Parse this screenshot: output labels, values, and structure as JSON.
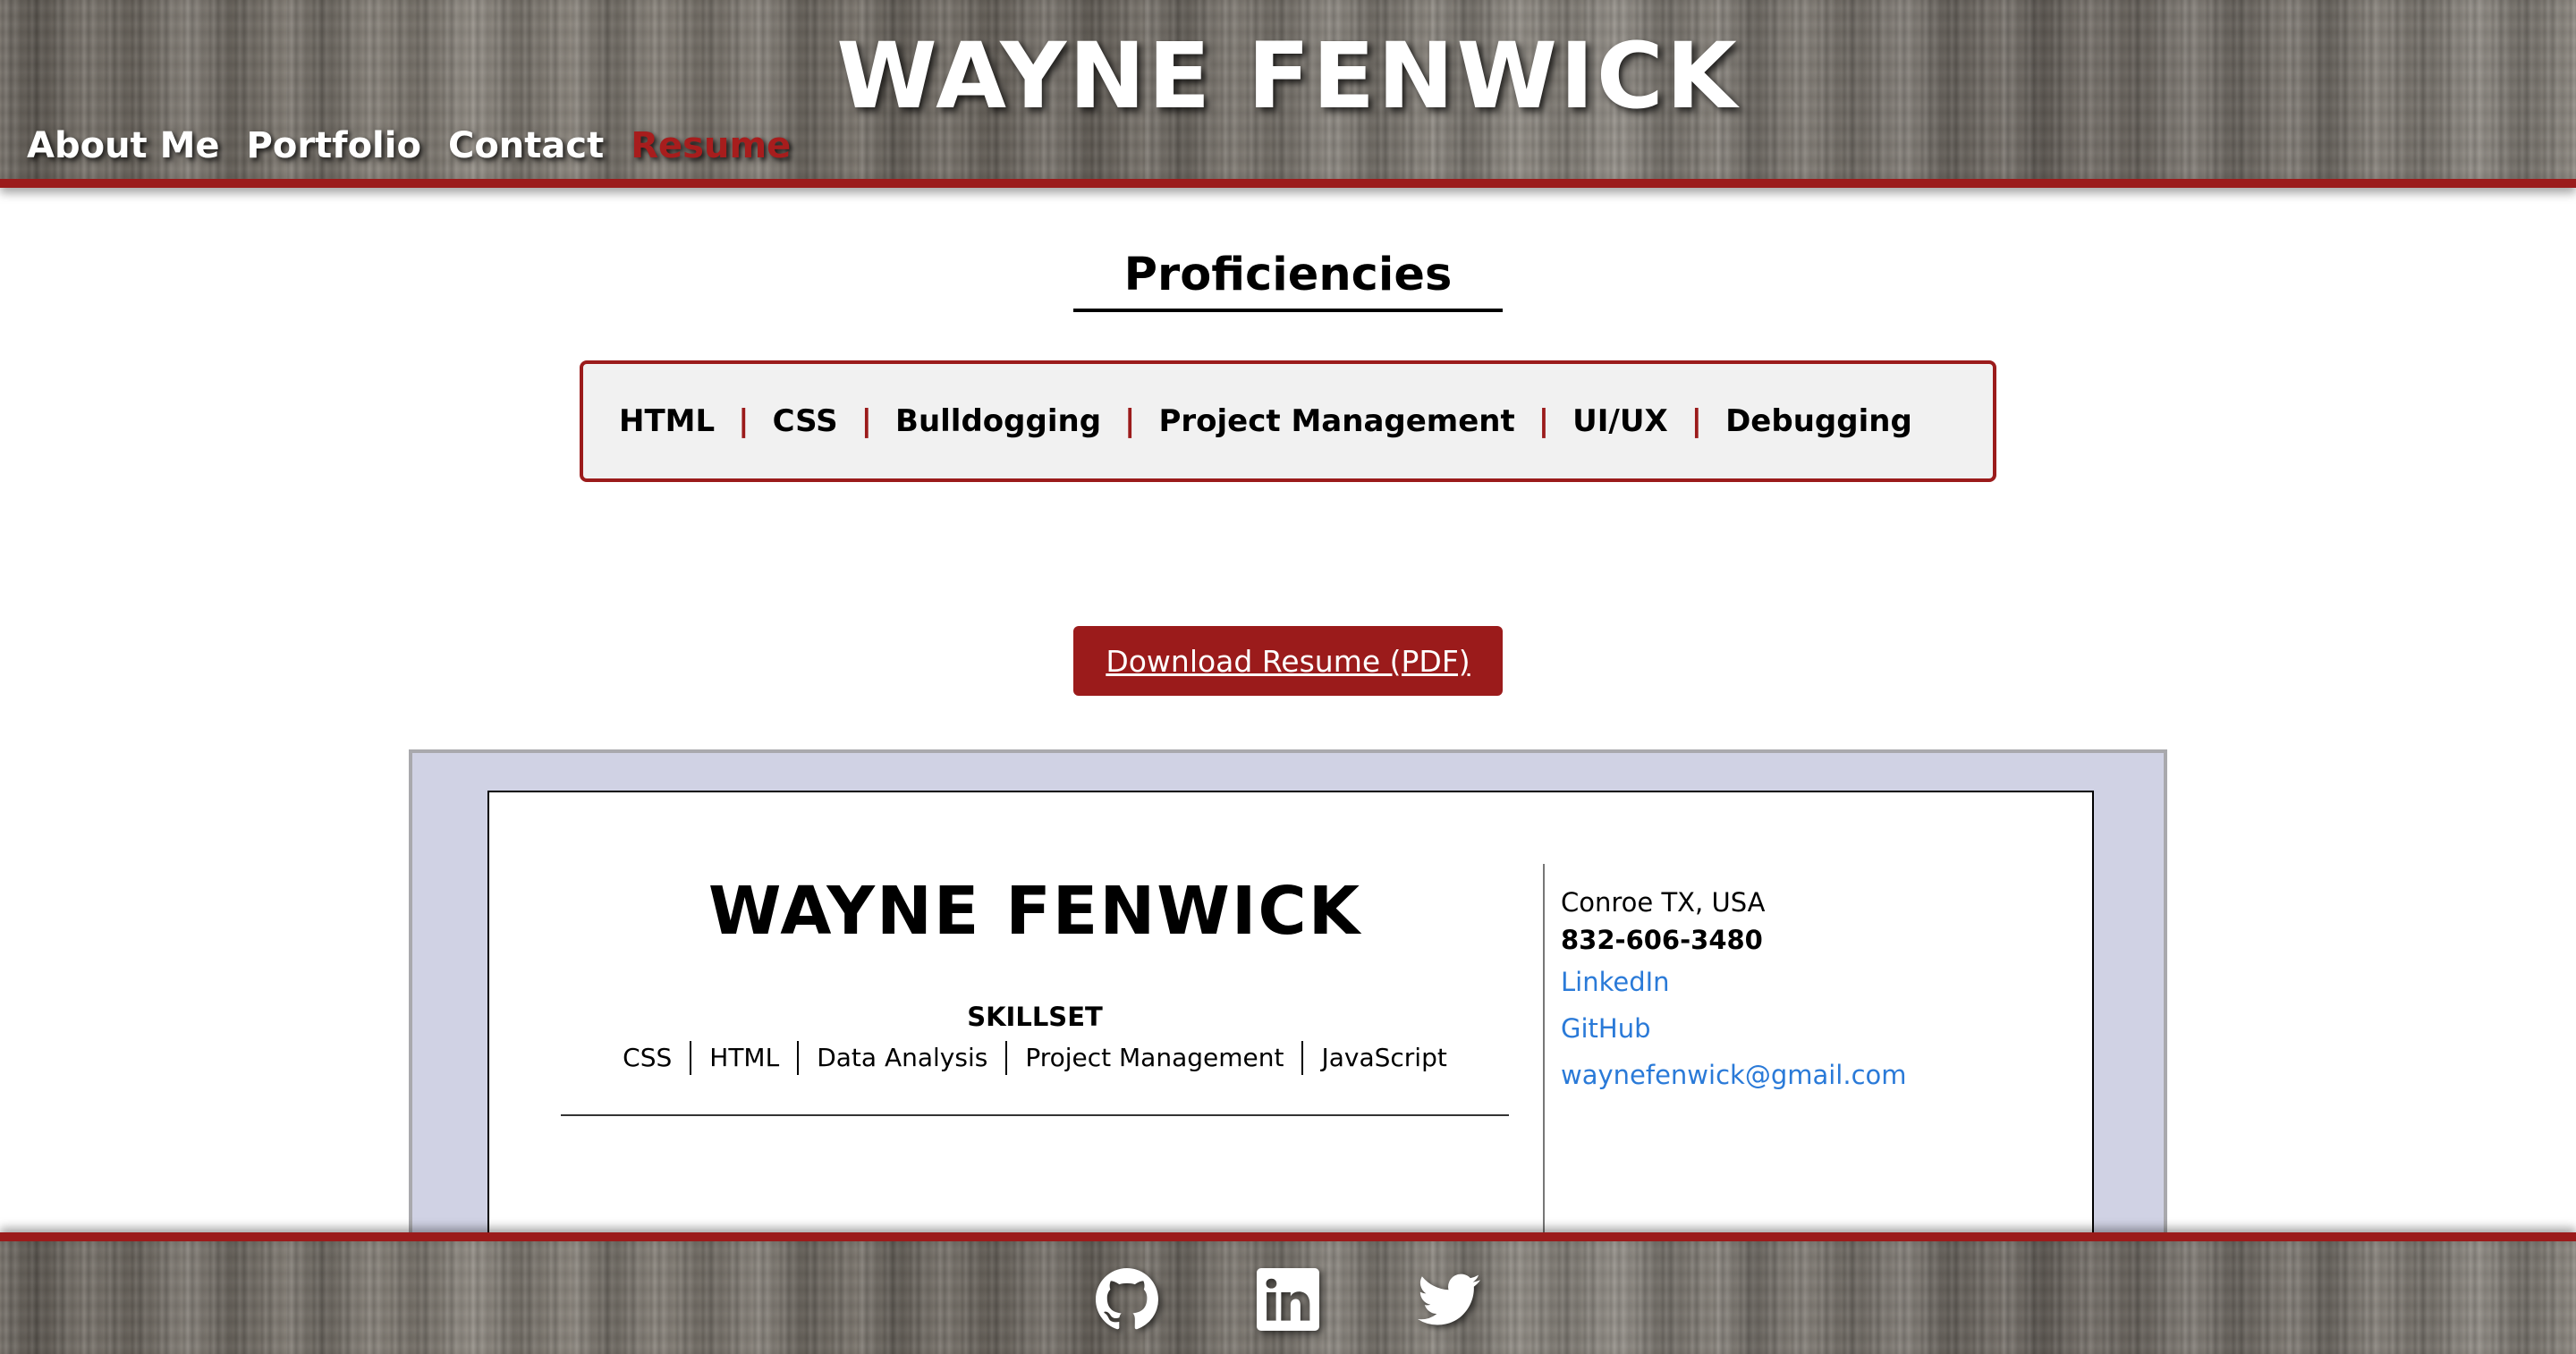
{
  "site": {
    "title": "WAYNE FENWICK"
  },
  "nav": {
    "items": [
      {
        "label": "About Me",
        "active": false
      },
      {
        "label": "Portfolio",
        "active": false
      },
      {
        "label": "Contact",
        "active": false
      },
      {
        "label": "Resume",
        "active": true
      }
    ]
  },
  "proficiencies": {
    "heading": "Proficiencies",
    "items": [
      "HTML",
      "CSS",
      "Bulldogging",
      "Project Management",
      "UI/UX",
      "Debugging"
    ],
    "separator": "|"
  },
  "download": {
    "label": "Download Resume (PDF)"
  },
  "resume_preview": {
    "name": "WAYNE FENWICK",
    "skillset_title": "SKILLSET",
    "skills": [
      "CSS",
      "HTML",
      "Data Analysis",
      "Project Management",
      "JavaScript"
    ],
    "location": "Conroe TX, USA",
    "phone": "832-606-3480",
    "links": [
      "LinkedIn",
      "GitHub",
      "waynefenwick@gmail.com"
    ]
  },
  "footer": {
    "icons": [
      "github-icon",
      "linkedin-icon",
      "twitter-icon"
    ]
  },
  "colors": {
    "accent": "#9b1b1b",
    "link": "#2a7ad8",
    "preview_bg": "#d0d2e4",
    "proficiency_bg": "#f1f1f1"
  }
}
